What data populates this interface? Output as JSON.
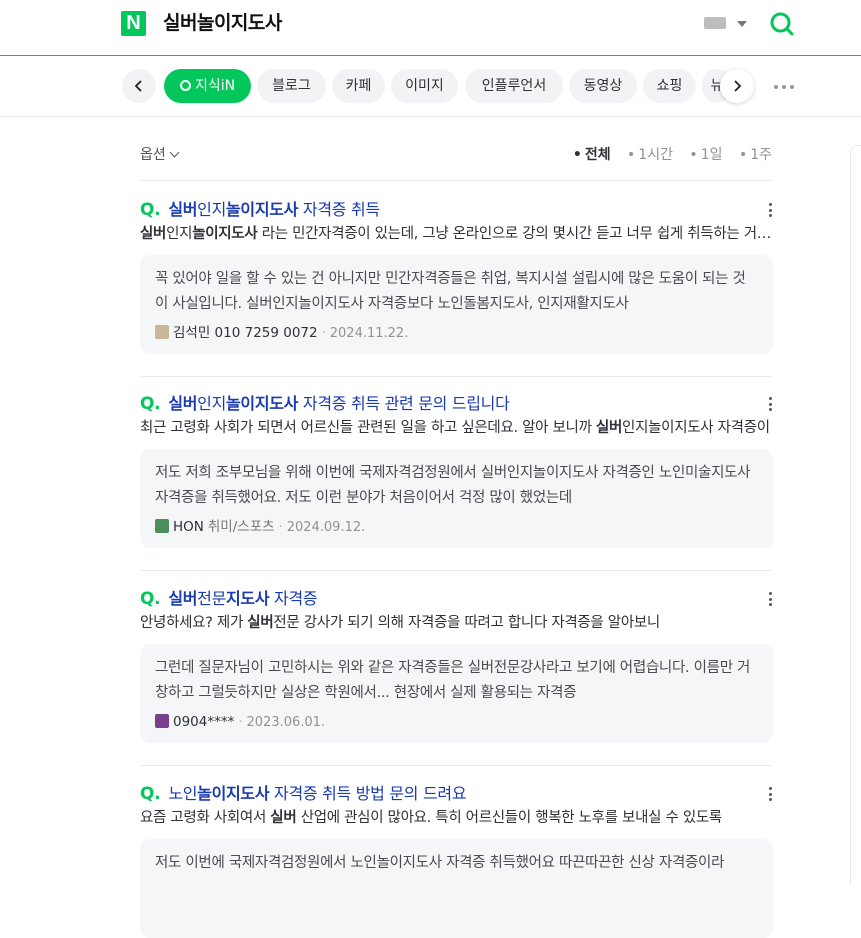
{
  "header": {
    "logo_letter": "N",
    "query": "실버놀이지도사",
    "icons": [
      "keyboard-icon",
      "caret-down-icon",
      "search-icon"
    ]
  },
  "tabs": [
    {
      "label": "지식iN",
      "active": true
    },
    {
      "label": "블로그"
    },
    {
      "label": "카페"
    },
    {
      "label": "이미지"
    },
    {
      "label": "인플루언서"
    },
    {
      "label": "동영상"
    },
    {
      "label": "쇼핑"
    },
    {
      "label": "뉴"
    }
  ],
  "options": {
    "label": "옵션",
    "filters": [
      "전체",
      "1시간",
      "1일",
      "1주"
    ],
    "selected": "전체"
  },
  "colors": {
    "brand": "#03c75a",
    "link": "#1a3ab0"
  },
  "results": [
    {
      "q_mark": "Q.",
      "title_parts": [
        [
          "실버",
          true
        ],
        [
          "인지",
          false
        ],
        [
          "놀이지도사",
          true
        ],
        [
          " 자격증 취득",
          false
        ]
      ],
      "desc_parts": [
        [
          "실버",
          true
        ],
        [
          "인지",
          false
        ],
        [
          "놀이지도사",
          true
        ],
        [
          " 라는 민간자격증이 있는데, 그냥 온라인으로 강의 몇시간 듣고 너무 쉽게 취득하는 거 같아서요.",
          false
        ]
      ],
      "answer": "꼭 있어야 일을 할 수 있는 건 아니지만 민간자격증들은 취업, 복지시설 설립시에 많은 도움이 되는 것이 사실입니다. 실버인지놀이지도사 자격증보다 노인돌봄지도사, 인지재활지도사",
      "author": "김석민 010 7259 0072",
      "category": "",
      "date": "2024.11.22.",
      "avatar_icon": "business-card-icon"
    },
    {
      "q_mark": "Q.",
      "title_parts": [
        [
          "실버",
          true
        ],
        [
          "인지",
          false
        ],
        [
          "놀이지도사",
          true
        ],
        [
          " 자격증 취득 관련 문의 드립니다",
          false
        ]
      ],
      "desc_parts": [
        [
          "최근 고령화 사회가 되면서 어르신들 관련된 일을 하고 싶은데요. 알아 보니까 ",
          false
        ],
        [
          "실버",
          true
        ],
        [
          "인지놀이지도사 자격증이",
          false
        ]
      ],
      "answer": "저도 저희 조부모님을 위해 이번에 국제자격검정원에서 실버인지놀이지도사 자격증인 노인미술지도사 자격증을 취득했어요. 저도 이런 분야가 처음이어서 걱정 많이 했었는데",
      "author": "HON",
      "category": "취미/스포츠",
      "date": "2024.09.12.",
      "avatar_icon": "plant-icon"
    },
    {
      "q_mark": "Q.",
      "title_parts": [
        [
          "실버",
          true
        ],
        [
          "전문",
          false
        ],
        [
          "지도사",
          true
        ],
        [
          " 자격증",
          false
        ]
      ],
      "desc_parts": [
        [
          "안녕하세요? 제가 ",
          false
        ],
        [
          "실버",
          true
        ],
        [
          "전문 강사가 되기 의해 자격증을 따려고 합니다 자격증을 알아보니",
          false
        ]
      ],
      "answer": "그런데 질문자님이 고민하시는 위와 같은 자격증들은 실버전문강사라고 보기에 어렵습니다. 이름만 거창하고 그럴듯하지만 실상은 학원에서... 현장에서 실제 활용되는 자격증",
      "author": "0904****",
      "category": "",
      "date": "2023.06.01.",
      "avatar_icon": "hat-icon"
    },
    {
      "q_mark": "Q.",
      "title_parts": [
        [
          "노인",
          false
        ],
        [
          "놀이지도사",
          true
        ],
        [
          " 자격증 취득 방법 문의 드려요",
          false
        ]
      ],
      "desc_parts": [
        [
          "요즘 고령화 사회여서 ",
          false
        ],
        [
          "실버",
          true
        ],
        [
          " 산업에 관심이 많아요. 특히 어르신들이 행복한 노후를 보내실 수 있도록",
          false
        ]
      ],
      "answer": "저도 이번에 국제자격검정원에서 노인놀이지도사 자격증 취득했어요 따끈따끈한 신상 자격증이라",
      "author": "",
      "category": "",
      "date": "",
      "avatar_icon": ""
    }
  ]
}
